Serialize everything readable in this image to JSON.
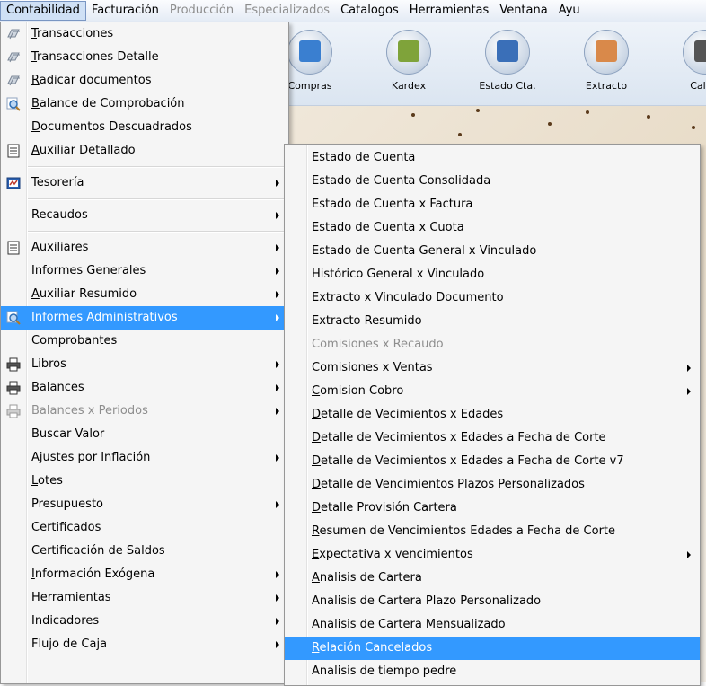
{
  "menubar": {
    "items": [
      {
        "label": "Contabilidad",
        "state": "active"
      },
      {
        "label": "Facturación",
        "state": "normal"
      },
      {
        "label": "Producción",
        "state": "disabled"
      },
      {
        "label": "Especializados",
        "state": "disabled"
      },
      {
        "label": "Catalogos",
        "state": "normal"
      },
      {
        "label": "Herramientas",
        "state": "normal"
      },
      {
        "label": "Ventana",
        "state": "normal"
      },
      {
        "label": "Ayu",
        "state": "normal"
      }
    ]
  },
  "toolbar": {
    "buttons": [
      {
        "label": "Compras",
        "icon": "truck-icon",
        "color": "#3a7fd0"
      },
      {
        "label": "Kardex",
        "icon": "clipboard-add-icon",
        "color": "#7fa33a"
      },
      {
        "label": "Estado Cta.",
        "icon": "id-card-icon",
        "color": "#3a6fb8"
      },
      {
        "label": "Extracto",
        "icon": "document-icon",
        "color": "#d9894a"
      },
      {
        "label": "Calcul",
        "icon": "calculator-icon",
        "color": "#555555"
      }
    ]
  },
  "main_menu": {
    "items": [
      {
        "label": "Transacciones",
        "icon": "transactions-icon",
        "underline": "T",
        "rest": "ransacciones"
      },
      {
        "label": "Transacciones Detalle",
        "icon": "transactions-icon",
        "underline": "T",
        "rest": "ransacciones Detalle"
      },
      {
        "label": "Radicar documentos",
        "icon": "transactions-icon",
        "underline": "R",
        "rest": "adicar documentos"
      },
      {
        "label": "Balance de Comprobación",
        "icon": "magnifier-icon",
        "underline": "B",
        "rest": "alance de Comprobación"
      },
      {
        "label": "Documentos Descuadrados",
        "icon": "",
        "underline": "D",
        "rest": "ocumentos Descuadrados"
      },
      {
        "label": "Auxiliar Detallado",
        "icon": "ledger-icon",
        "underline": "A",
        "rest": "uxiliar Detallado"
      },
      {
        "label": "Tesorería",
        "icon": "treasury-icon",
        "submenu": true
      },
      {
        "label": "Recaudos",
        "icon": "",
        "submenu": true
      },
      {
        "label": "Auxiliares",
        "icon": "ledger-icon",
        "submenu": true
      },
      {
        "label": "Informes Generales",
        "icon": "",
        "submenu": true
      },
      {
        "label": "Auxiliar Resumido",
        "icon": "",
        "underline": "A",
        "rest": "uxiliar Resumido",
        "submenu": true
      },
      {
        "label": "Informes Administrativos",
        "icon": "magnifier-icon",
        "submenu": true,
        "selected": true
      },
      {
        "label": "Comprobantes",
        "icon": ""
      },
      {
        "label": "Libros",
        "icon": "printer-icon",
        "submenu": true
      },
      {
        "label": "Balances",
        "icon": "printer-icon",
        "submenu": true
      },
      {
        "label": "Balances x Periodos",
        "icon": "printer-icon",
        "submenu": true,
        "disabled": true
      },
      {
        "label": "Buscar Valor",
        "icon": ""
      },
      {
        "label": "Ajustes por Inflación",
        "icon": "",
        "underline": "A",
        "rest": "justes por Inflación",
        "submenu": true
      },
      {
        "label": "Lotes",
        "icon": "",
        "underline": "L",
        "rest": "otes"
      },
      {
        "label": "Presupuesto",
        "icon": "",
        "submenu": true
      },
      {
        "label": "Certificados",
        "icon": "",
        "underline": "C",
        "rest": "ertificados"
      },
      {
        "label": "Certificación de Saldos",
        "icon": ""
      },
      {
        "label": "Información Exógena",
        "icon": "",
        "underline": "I",
        "rest": "nformación Exógena",
        "submenu": true
      },
      {
        "label": "Herramientas",
        "icon": "",
        "underline": "H",
        "rest": "erramientas",
        "submenu": true
      },
      {
        "label": "Indicadores",
        "icon": "",
        "submenu": true
      },
      {
        "label": "Flujo de Caja",
        "icon": "",
        "submenu": true
      }
    ]
  },
  "sub_menu": {
    "items": [
      {
        "label": "Estado de Cuenta"
      },
      {
        "label": "Estado de Cuenta Consolidada"
      },
      {
        "label": "Estado de Cuenta x Factura"
      },
      {
        "label": "Estado de Cuenta x Cuota"
      },
      {
        "label": "Estado de Cuenta General x Vinculado"
      },
      {
        "label": "Histórico General x Vinculado"
      },
      {
        "label": "Extracto x Vinculado Documento"
      },
      {
        "label": "Extracto Resumido"
      },
      {
        "label": "Comisiones x Recaudo",
        "disabled": true
      },
      {
        "label": "Comisiones x Ventas",
        "submenu": true
      },
      {
        "label": "Comision Cobro",
        "underline": "C",
        "rest": "omision Cobro",
        "submenu": true
      },
      {
        "label": "Detalle de Vecimientos x Edades",
        "underline": "D",
        "rest": "etalle de Vecimientos x Edades"
      },
      {
        "label": "Detalle de Vecimientos x Edades a Fecha de Corte",
        "underline": "D",
        "rest": "etalle de Vecimientos x Edades a Fecha de Corte"
      },
      {
        "label": "Detalle de Vecimientos x Edades a Fecha de Corte v7",
        "underline": "D",
        "rest": "etalle de Vecimientos x Edades a Fecha de Corte v7"
      },
      {
        "label": "Detalle de Vencimientos Plazos Personalizados",
        "underline": "D",
        "rest": "etalle de Vencimientos Plazos Personalizados"
      },
      {
        "label": "Detalle Provisión Cartera",
        "underline": "D",
        "rest": "etalle Provisión Cartera"
      },
      {
        "label": "Resumen de Vencimientos Edades a Fecha de Corte",
        "underline": "R",
        "rest": "esumen de Vencimientos Edades a Fecha de Corte"
      },
      {
        "label": "Expectativa x vencimientos",
        "underline": "E",
        "rest": "xpectativa x vencimientos",
        "submenu": true
      },
      {
        "label": "Analisis de Cartera",
        "underline": "A",
        "rest": "nalisis de Cartera"
      },
      {
        "label": "Analisis de Cartera Plazo Personalizado"
      },
      {
        "label": "Analisis de Cartera Mensualizado"
      },
      {
        "label": "Relación Cancelados",
        "underline": "R",
        "rest": "elación Cancelados",
        "selected": true
      },
      {
        "label": "Analisis de tiempo pedre"
      }
    ]
  }
}
